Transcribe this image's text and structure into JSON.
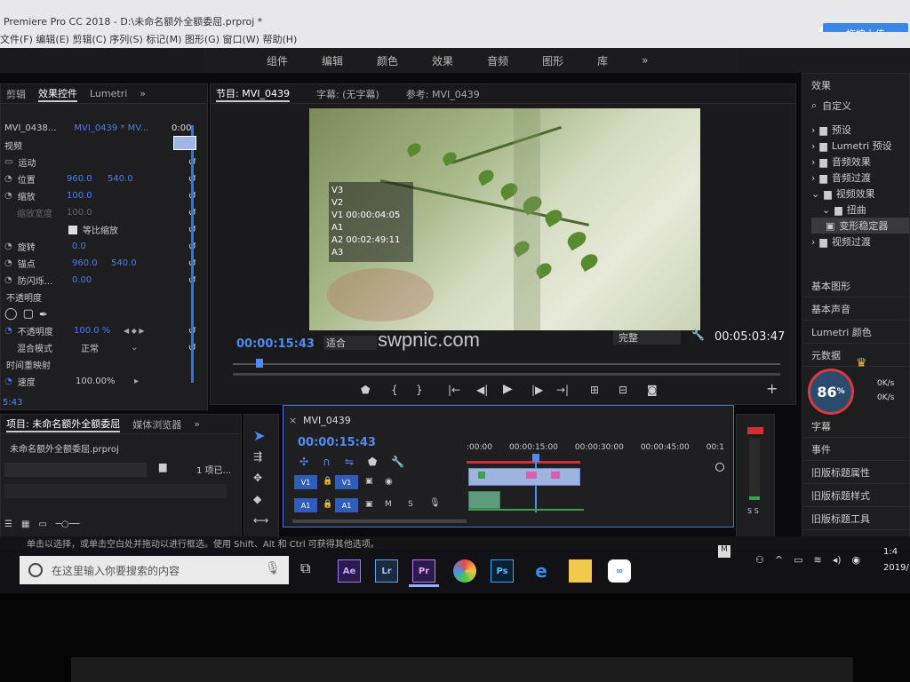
{
  "window": {
    "title": "Premiere Pro CC 2018 - D:\\未命名额外全额委屈.prproj *",
    "menu": [
      "文件(F)",
      "编辑(E)",
      "剪辑(C)",
      "序列(S)",
      "标记(M)",
      "图形(G)",
      "窗口(W)",
      "帮助(H)"
    ],
    "upload_label": "拖拽上传"
  },
  "workspaces": [
    "组件",
    "编辑",
    "颜色",
    "效果",
    "音频",
    "图形",
    "库",
    "»"
  ],
  "effect_controls": {
    "tabs": [
      "剪辑",
      "效果控件",
      "Lumetri",
      "»"
    ],
    "clip_source": "MVI_0438...",
    "clip_seq": "MVI_0439 * MV...",
    "header_tc": "0:00",
    "video_label": "视频",
    "motion": "运动",
    "position_label": "位置",
    "position_x": "960.0",
    "position_y": "540.0",
    "scale_label": "缩放",
    "scale_value": "100.0",
    "scale_width_label": "缩放宽度",
    "scale_width_value": "100.0",
    "uniform_label": "等比缩放",
    "rotation_label": "旋转",
    "rotation_value": "0.0",
    "anchor_label": "锚点",
    "anchor_x": "960.0",
    "anchor_y": "540.0",
    "flicker_label": "防闪烁...",
    "flicker_value": "0.00",
    "opacity_section": "不透明度",
    "opacity_label": "不透明度",
    "opacity_value": "100.0 %",
    "blend_label": "混合模式",
    "blend_value": "正常",
    "remap_label": "时间重映射",
    "speed_label": "速度",
    "speed_value": "100.00%",
    "bottom_tc": "5:43"
  },
  "program": {
    "tab_program": "节目: MVI_0439",
    "tab_captions": "字幕: (无字幕)",
    "tab_ref": "参考: MVI_0439",
    "overlay": [
      "V3",
      "V2",
      "V1 00:00:04:05",
      "A1",
      "A2 00:02:49:11",
      "A3"
    ],
    "current_tc": "00:00:15:43",
    "fit": "适合",
    "quality": "完整",
    "duration": "00:05:03:47",
    "watermark": "swpnic.com"
  },
  "project": {
    "tab_project": "项目: 未命名额外全额委屈",
    "tab_media": "媒体浏览器",
    "file": "未命名额外全额委屈.prproj",
    "count": "1 项已..."
  },
  "timeline": {
    "seq_name": "MVI_0439",
    "tc": "00:00:15:43",
    "ruler": [
      ":00:00",
      "00:00:15:00",
      "00:00:30:00",
      "00:00:45:00",
      "00:1"
    ],
    "v1": "V1",
    "a1": "A1"
  },
  "effects_panel": {
    "title": "效果",
    "search": "自定义",
    "tree": [
      "预设",
      "Lumetri 预设",
      "音频效果",
      "音频过渡",
      "视频效果",
      "扭曲",
      "变形稳定器",
      "视频过渡"
    ],
    "sections": [
      "基本图形",
      "基本声音",
      "Lumetri 颜色",
      "元数据",
      "字幕",
      "事件",
      "旧版标题属性",
      "旧版标题样式",
      "旧版标题工具"
    ],
    "gauge_value": "86",
    "gauge_unit": "%",
    "up_rate": "0K/s",
    "down_rate": "0K/s"
  },
  "status": {
    "hint": "单击以选择，或单击空白处并拖动以进行框选。使用 Shift、Alt 和 Ctrl 可获得其他选项。"
  },
  "taskbar": {
    "search_placeholder": "在这里输入你要搜索的内容",
    "time": "1:4",
    "date": "2019/",
    "apps": [
      "Ae",
      "Lr",
      "Pr",
      "Ps"
    ]
  }
}
